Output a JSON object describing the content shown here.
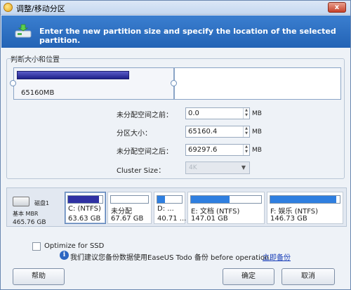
{
  "window": {
    "title": "调整/移动分区",
    "close_glyph": "x"
  },
  "banner": {
    "text": "Enter the new partition size and specify the location of the selected partition."
  },
  "size_group": {
    "label": "判断大小和位置",
    "partition_size_label": "65160MB"
  },
  "fields": {
    "before": {
      "label": "未分配空间之前：",
      "value": "0.0",
      "unit": "MB"
    },
    "size": {
      "label": "分区大小：",
      "value": "65160.4",
      "unit": "MB"
    },
    "after": {
      "label": "未分配空间之后：",
      "value": "69297.6",
      "unit": "MB"
    },
    "cluster": {
      "label": "Cluster Size：",
      "value": "4K"
    }
  },
  "disk": {
    "name": "磁盘1",
    "type": "基本 MBR",
    "size": "465.76 GB",
    "partitions": [
      {
        "name": "C: (NTFS)",
        "size": "63.63 GB",
        "used_fraction": 0.9,
        "color": "#2f31a3"
      },
      {
        "name": "未分配",
        "size": "67.67 GB",
        "used_fraction": 0.0,
        "color": "#ffffff"
      },
      {
        "name": "D: ...",
        "size": "40.71 ...",
        "used_fraction": 0.3,
        "color": "#2f7fe0"
      },
      {
        "name": "E: 文档 (NTFS)",
        "size": "147.01 GB",
        "used_fraction": 0.55,
        "color": "#2f7fe0"
      },
      {
        "name": "F: 娱乐 (NTFS)",
        "size": "146.73 GB",
        "used_fraction": 0.95,
        "color": "#2f7fe0"
      }
    ]
  },
  "optimize": {
    "label": "Optimize for SSD",
    "checked": false
  },
  "notice": {
    "text": "我们建议您备份数据使用EaseUS Todo 备份 before operation.",
    "link": "立即备份",
    "icon": "info-icon"
  },
  "buttons": {
    "help": "帮助",
    "ok": "确定",
    "cancel": "取消"
  },
  "colors": {
    "banner": "#2a6bc0",
    "accent": "#1e2089"
  }
}
